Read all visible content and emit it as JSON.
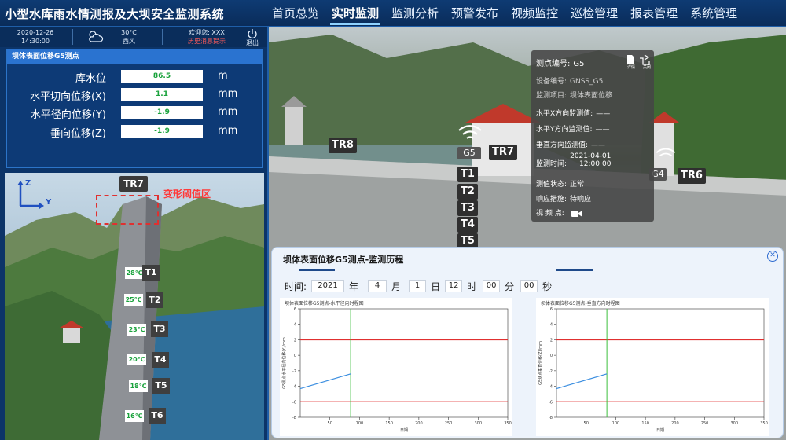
{
  "app": {
    "title": "小型水库雨水情测报及大坝安全监测系统"
  },
  "nav": {
    "items": [
      "首页总览",
      "实时监测",
      "监测分析",
      "预警发布",
      "视频监控",
      "巡检管理",
      "报表管理",
      "系统管理"
    ],
    "active": 1
  },
  "infobar": {
    "date": "2020-12-26",
    "time": "14:30:00",
    "temperature": "30°C",
    "wind": "西风",
    "welcome": "欢迎您: XXX",
    "user_link": "历史消息提示",
    "logout": "退出",
    "weather_icon": "partly-cloudy-icon",
    "power_icon": "power-icon"
  },
  "measure": {
    "header": "坝体表面位移G5测点",
    "rows": [
      {
        "label": "库水位",
        "value": "86.5",
        "unit": "m"
      },
      {
        "label": "水平切向位移(X)",
        "value": "1.1",
        "unit": "mm"
      },
      {
        "label": "水平径向位移(Y)",
        "value": "-1.9",
        "unit": "mm"
      },
      {
        "label": "垂向位移(Z)",
        "value": "-1.9",
        "unit": "mm"
      }
    ]
  },
  "scene3d": {
    "axis_z": "Z",
    "axis_y": "Y",
    "tr7": "TR7",
    "threshold_label": "变形阈值区",
    "temps": [
      "28℃",
      "25℃",
      "23℃",
      "20℃",
      "18℃",
      "16℃"
    ],
    "tags": [
      "T1",
      "T2",
      "T3",
      "T4",
      "T5",
      "T6"
    ]
  },
  "scene": {
    "tags": {
      "tr8": "TR8",
      "tr7": "TR7",
      "g5": "G5",
      "g4": "G4",
      "tr6": "TR6"
    },
    "t_list": [
      "T1",
      "T2",
      "T3",
      "T4",
      "T5"
    ]
  },
  "popup": {
    "point_code_label": "测点编号:",
    "point_code": "G5",
    "device_label": "设备编号:",
    "device": "GNSS_G5",
    "item_label": "监测项目:",
    "item": "坝体表面位移",
    "x_label": "水平X方向监测值:",
    "x_value": "——",
    "y_label": "水平Y方向监测值:",
    "y_value": "——",
    "z_label": "垂直方向监测值:",
    "z_value": "——",
    "time_label": "监测时间:",
    "time_date": "2021-04-01",
    "time_clock": "12:00:00",
    "status_label": "测值状态:",
    "status": "正常",
    "response_label": "响应措施:",
    "response": "待响应",
    "video_label": "视 频 点:",
    "icon_detail": "详情",
    "icon_share": "关闭"
  },
  "history": {
    "title": "坝体表面位移G5测点-监测历程",
    "time_label": "时间:",
    "year": "2021",
    "year_unit": "年",
    "month": "4",
    "month_unit": "月",
    "day": "1",
    "day_unit": "日",
    "hour": "12",
    "hour_unit": "时",
    "minute": "00",
    "minute_unit": "分",
    "second": "00",
    "second_unit": "秒"
  },
  "chart_data": [
    {
      "type": "line",
      "title": "坝体表面位移G5测点-水平径向时程图",
      "xlabel": "日期",
      "ylabel": "G5测点水平径向位移(Y)/mm",
      "xlim": [
        0,
        350
      ],
      "ylim": [
        -8,
        6
      ],
      "xticks": [
        50,
        100,
        150,
        200,
        250,
        300,
        350
      ],
      "yticks": [
        -8,
        -6,
        -4,
        -2,
        0,
        2,
        4,
        6
      ],
      "series": [
        {
          "x": [
            0,
            85
          ],
          "y": [
            -4.3,
            -2.4
          ],
          "color": "#3b8ee0"
        }
      ],
      "hlines": [
        {
          "y": 2,
          "color": "#e03030"
        },
        {
          "y": -6,
          "color": "#e03030"
        }
      ],
      "vline": {
        "x": 85,
        "color": "#3cc03c"
      }
    },
    {
      "type": "line",
      "title": "坝体表面位移G5测点-垂直方向时程图",
      "xlabel": "日期",
      "ylabel": "G5测点垂直位移(Z)/mm",
      "xlim": [
        0,
        350
      ],
      "ylim": [
        -8,
        6
      ],
      "xticks": [
        50,
        100,
        150,
        200,
        250,
        300,
        350
      ],
      "yticks": [
        -8,
        -6,
        -4,
        -2,
        0,
        2,
        4,
        6
      ],
      "series": [
        {
          "x": [
            0,
            85
          ],
          "y": [
            -4.3,
            -2.4
          ],
          "color": "#3b8ee0"
        }
      ],
      "hlines": [
        {
          "y": 2,
          "color": "#e03030"
        },
        {
          "y": -6,
          "color": "#e03030"
        }
      ],
      "vline": {
        "x": 85,
        "color": "#3cc03c"
      }
    }
  ]
}
